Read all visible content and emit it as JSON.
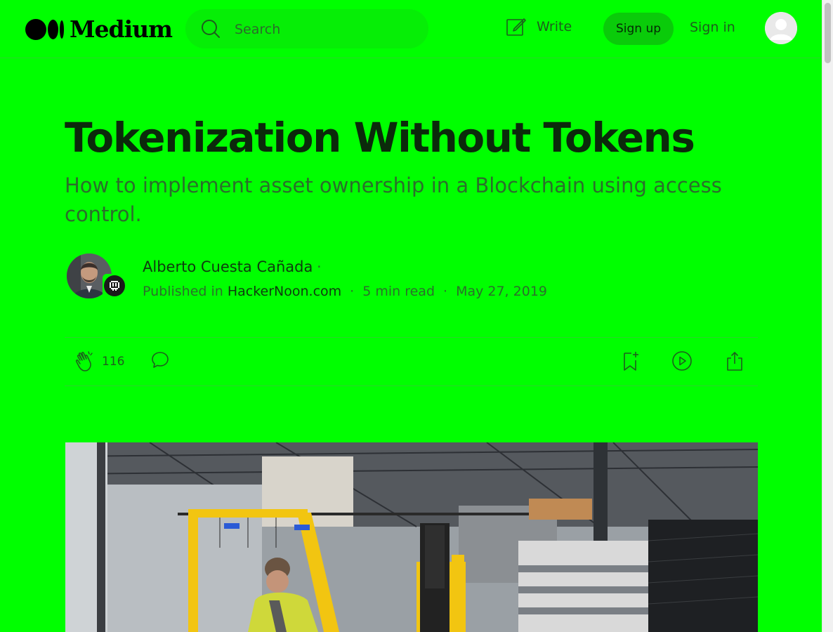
{
  "header": {
    "logo_text": "Medium",
    "search": {
      "placeholder": "Search"
    },
    "write_label": "Write",
    "signup_label": "Sign up",
    "signin_label": "Sign in"
  },
  "article": {
    "title": "Tokenization Without Tokens",
    "subtitle": "How to implement asset ownership in a Blockchain using access control.",
    "author": "Alberto Cuesta Cañada",
    "author_dot": "·",
    "published_prefix": "Published in",
    "publication": "HackerNoon.com",
    "read_time": "5 min read",
    "date": "May 27, 2019",
    "separator": "·",
    "clap_count": "116"
  },
  "colors": {
    "background": "#00ff00",
    "title": "#0b2a0b",
    "subtitle": "#2b6f2b",
    "signup_bg": "#0acb0a"
  },
  "icons": [
    "medium-logo-icon",
    "search-icon",
    "write-icon",
    "avatar-icon",
    "clap-icon",
    "comment-icon",
    "bookmark-icon",
    "play-icon",
    "share-icon"
  ]
}
